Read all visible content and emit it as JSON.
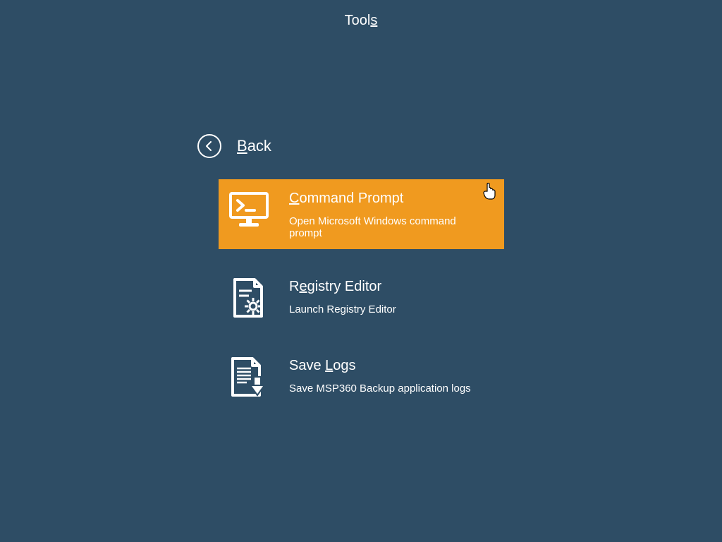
{
  "header": {
    "title_pre": "Tool",
    "title_accel": "s"
  },
  "back": {
    "label_accel": "B",
    "label_rest": "ack"
  },
  "items": [
    {
      "title_accel": "C",
      "title_rest": "ommand Prompt",
      "desc": "Open Microsoft Windows command prompt"
    },
    {
      "title_pre": "R",
      "title_accel": "e",
      "title_rest": "gistry Editor",
      "desc": "Launch Registry Editor"
    },
    {
      "title_pre": "Save ",
      "title_accel": "L",
      "title_rest": "ogs",
      "desc": "Save MSP360 Backup application logs"
    }
  ]
}
